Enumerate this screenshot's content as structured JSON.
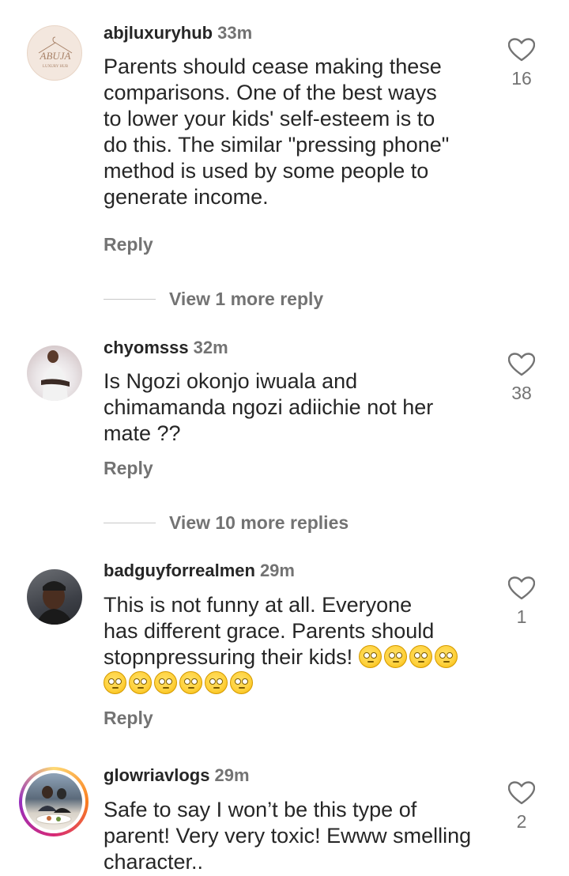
{
  "reply_label": "Reply",
  "comments": [
    {
      "username": "abjluxuryhub",
      "time": "33m",
      "lines": [
        "Parents should cease making these",
        "comparisons. One of the best ways",
        "to lower your kids' self-esteem is to",
        "do this. The similar \"pressing phone\"",
        "method is used by some people to",
        "generate income."
      ],
      "likes": "16",
      "view_more": "View 1 more reply",
      "avatar_logo_text": "ABUJA",
      "avatar_logo_sub": "LUXURY HUB"
    },
    {
      "username": "chyomsss",
      "time": "32m",
      "lines": [
        "Is Ngozi okonjo iwuala and",
        "chimamanda ngozi adiichie not her",
        "mate ??"
      ],
      "likes": "38",
      "view_more": "View 10 more replies"
    },
    {
      "username": "badguyforrealmen",
      "time": "29m",
      "lines": [
        "This is not funny at all. Everyone",
        "has different grace. Parents should",
        "stopnpressuring their kids!"
      ],
      "emoji_line1_count": 4,
      "emoji_line2_count": 6,
      "emoji_name": "face-with-rolling-eyes",
      "likes": "1"
    },
    {
      "username": "glowriavlogs",
      "time": "29m",
      "lines": [
        "Safe to say I won’t be this type of",
        "parent! Very very toxic! Ewww smelling",
        "character.."
      ],
      "likes": "2",
      "story_ring": true
    }
  ],
  "colors": {
    "text": "#262626",
    "secondary": "#737373",
    "divider": "#c7c7c7",
    "story_ring": [
      "#feda75",
      "#fa7e1e",
      "#d62976",
      "#962fbf"
    ]
  },
  "icons": {
    "like": "heart-outline-icon"
  }
}
